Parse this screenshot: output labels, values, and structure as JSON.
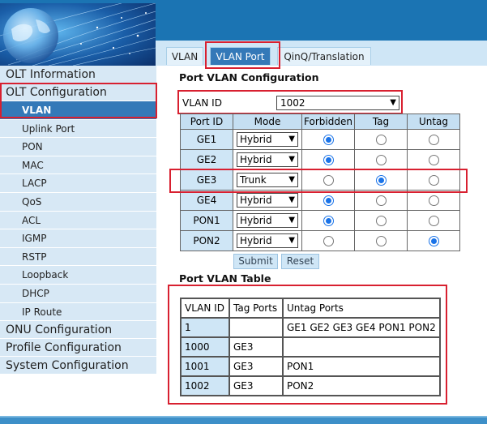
{
  "colors": {
    "accent": "#1b74b3",
    "highlight": "#d82030",
    "sidebar_bg": "#d7e8f5",
    "active_bg": "#3479b8"
  },
  "sidebar": {
    "olt_information": "OLT Information",
    "olt_configuration": "OLT Configuration",
    "sub_items": [
      "VLAN",
      "Uplink Port",
      "PON",
      "MAC",
      "LACP",
      "QoS",
      "ACL",
      "IGMP",
      "RSTP",
      "Loopback",
      "DHCP",
      "IP Route"
    ],
    "onu_configuration": "ONU Configuration",
    "profile_configuration": "Profile Configuration",
    "system_configuration": "System Configuration"
  },
  "tabs": [
    "VLAN",
    "VLAN Port",
    "QinQ/Translation"
  ],
  "port_vlan_config": {
    "title": "Port VLAN Configuration",
    "vlan_id_label": "VLAN ID",
    "vlan_id_value": "1002",
    "headers": [
      "Port ID",
      "Mode",
      "Forbidden",
      "Tag",
      "Untag"
    ],
    "rows": [
      {
        "port": "GE1",
        "mode": "Hybrid",
        "selected": "Forbidden"
      },
      {
        "port": "GE2",
        "mode": "Hybrid",
        "selected": "Forbidden"
      },
      {
        "port": "GE3",
        "mode": "Trunk",
        "selected": "Tag"
      },
      {
        "port": "GE4",
        "mode": "Hybrid",
        "selected": "Forbidden"
      },
      {
        "port": "PON1",
        "mode": "Hybrid",
        "selected": "Forbidden"
      },
      {
        "port": "PON2",
        "mode": "Hybrid",
        "selected": "Untag"
      }
    ],
    "submit_label": "Submit",
    "reset_label": "Reset"
  },
  "port_vlan_table": {
    "title": "Port VLAN Table",
    "headers": [
      "VLAN ID",
      "Tag Ports",
      "Untag Ports"
    ],
    "rows": [
      [
        "1",
        "",
        "GE1 GE2 GE3 GE4 PON1 PON2"
      ],
      [
        "1000",
        "GE3",
        ""
      ],
      [
        "1001",
        "GE3",
        "PON1"
      ],
      [
        "1002",
        "GE3",
        "PON2"
      ]
    ]
  }
}
